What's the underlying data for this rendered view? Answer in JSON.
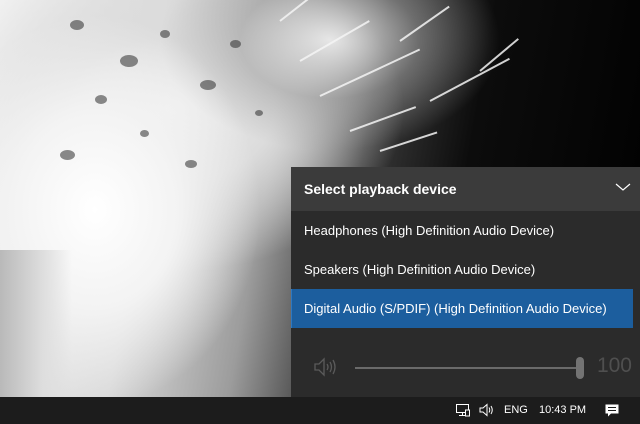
{
  "flyout": {
    "title": "Select playback device",
    "expand_icon": "chevron-down-icon",
    "devices": [
      {
        "label": "Headphones (High Definition Audio Device)",
        "selected": false
      },
      {
        "label": "Speakers (High Definition Audio Device)",
        "selected": false
      },
      {
        "label": "Digital Audio (S/PDIF) (High Definition Audio Device)",
        "selected": true
      }
    ],
    "volume": {
      "icon": "speaker-volume-icon",
      "value": "100",
      "level_percent": 100
    }
  },
  "taskbar": {
    "network_icon": "network-icon",
    "volume_icon": "volume-icon",
    "language": "ENG",
    "time": "10:43 PM",
    "action_center_icon": "action-center-icon"
  },
  "colors": {
    "flyout_bg": "#2b2b2b",
    "header_bg": "#3b3b3b",
    "selected_bg": "#1c5e9e",
    "taskbar_bg": "#1c1c1c"
  }
}
